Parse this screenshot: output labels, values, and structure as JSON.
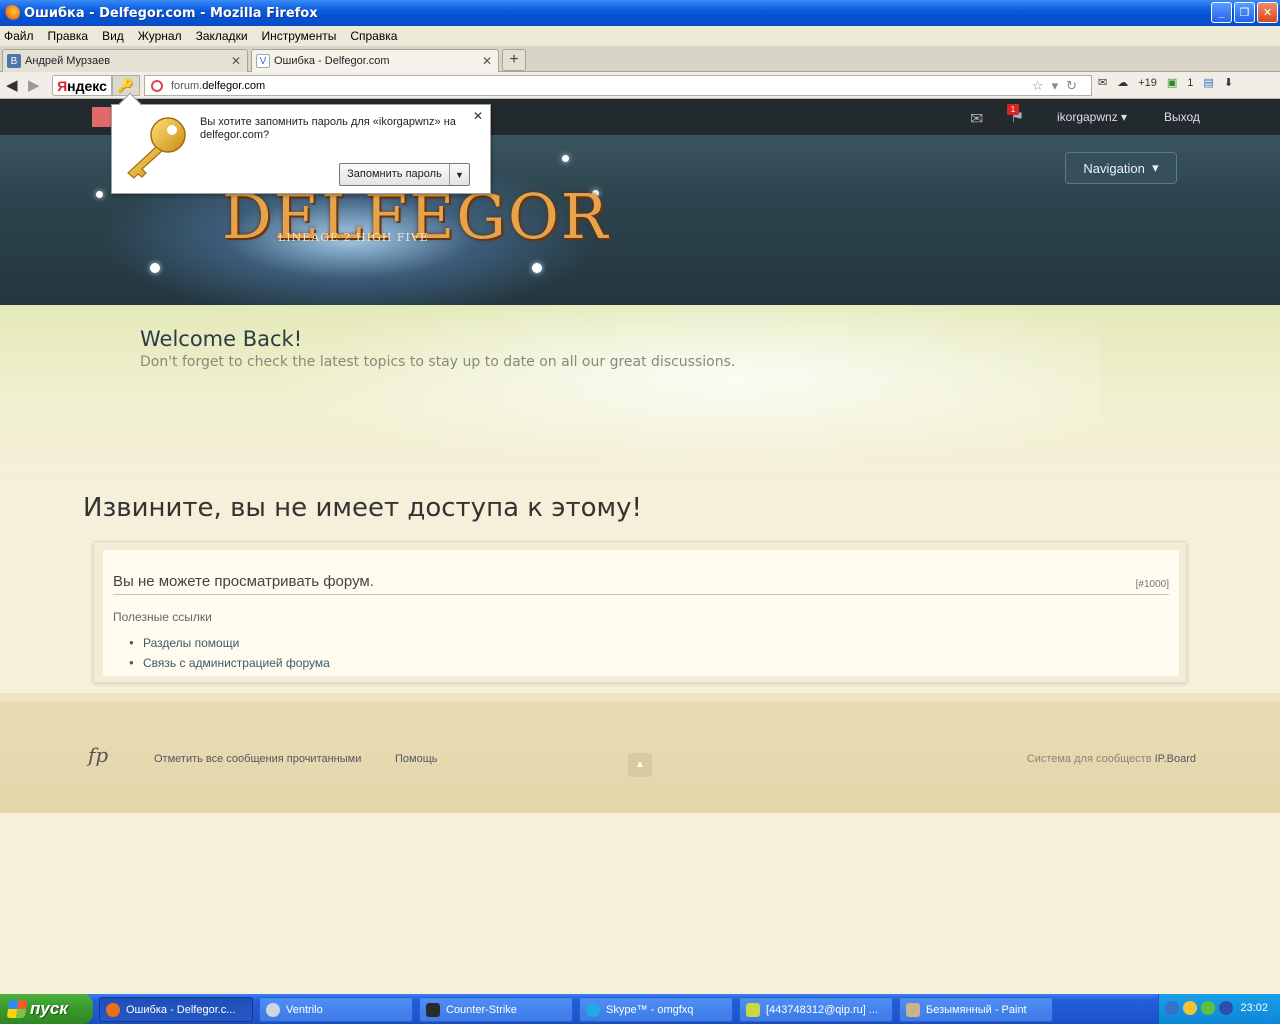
{
  "window": {
    "title": "Ошибка - Delfegor.com - Mozilla Firefox"
  },
  "menu": [
    "Файл",
    "Правка",
    "Вид",
    "Журнал",
    "Закладки",
    "Инструменты",
    "Справка"
  ],
  "tabs": [
    {
      "label": "Андрей Мурзаев",
      "icon": "vk-icon"
    },
    {
      "label": "Ошибка - Delfegor.com",
      "icon": "site-icon"
    }
  ],
  "navbar": {
    "yandex_prefix": "Я",
    "yandex_rest": "ндекс",
    "url_host": "forum.",
    "url_domain": "delfegor.com",
    "mail_count": "+19",
    "ext_count": "1"
  },
  "site": {
    "username": "ikorgapwnz",
    "logout": "Выход",
    "notif_count": "1",
    "navigation": "Navigation",
    "logo": "DELFEGOR",
    "sublogo": "LINEAGE 2 HIGH FIVE"
  },
  "welcome": {
    "title": "Welcome Back!",
    "text": "Don't forget to check the latest topics to stay up to date on all our great discussions."
  },
  "error": {
    "title": "Извините, вы не имеет доступа к этому!",
    "message": "Вы не можете просматривать форум.",
    "code": "[#1000]",
    "links_title": "Полезные ссылки",
    "links": [
      "Разделы помощи",
      "Связь с администрацией форума"
    ]
  },
  "footer": {
    "logo": "fp",
    "mark_read": "Отметить все сообщения прочитанными",
    "help": "Помощь",
    "powered_prefix": "Система для сообществ ",
    "powered_brand": "IP.Board"
  },
  "popup": {
    "text": "Вы хотите запомнить пароль для «ikorgapwnz» на delfegor.com?",
    "button": "Запомнить пароль"
  },
  "taskbar": {
    "start": "пуск",
    "tasks": [
      {
        "label": "Ошибка - Delfegor.c...",
        "color": "#e8701a"
      },
      {
        "label": "Ventrilo",
        "color": "#cfd6e0"
      },
      {
        "label": "Counter-Strike",
        "color": "#2b2b2b"
      },
      {
        "label": "Skype™ - omgfxq",
        "color": "#22a9e6"
      },
      {
        "label": "[443748312@qip.ru] ...",
        "color": "#c8d840"
      },
      {
        "label": "Безымянный - Paint",
        "color": "#c9b38a"
      }
    ],
    "clock": "23:02"
  }
}
